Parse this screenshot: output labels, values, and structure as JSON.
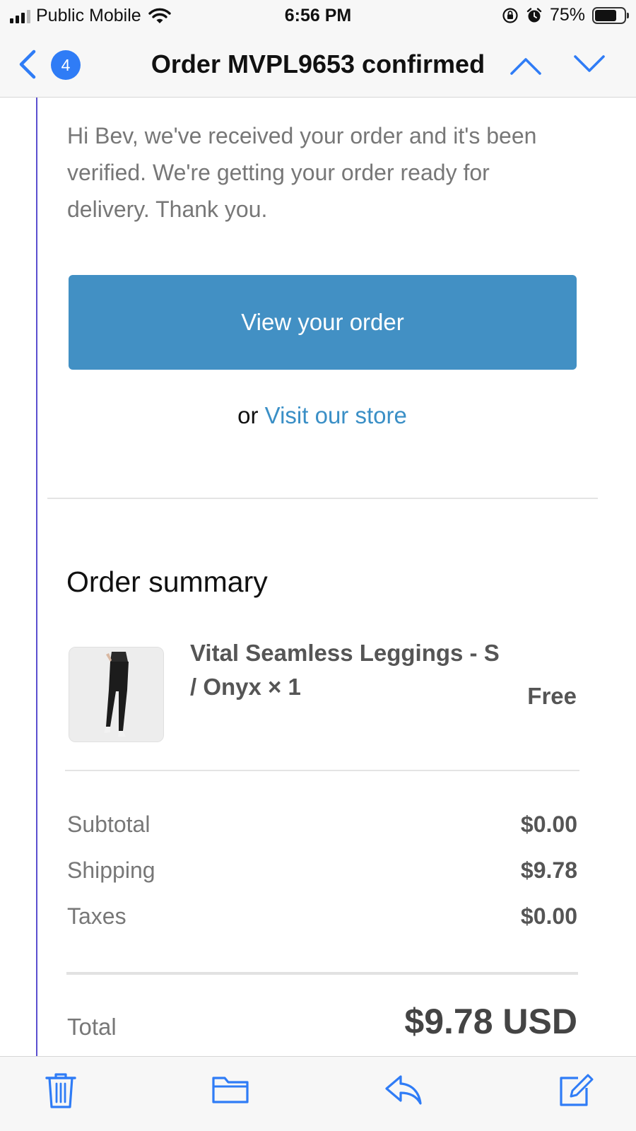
{
  "status_bar": {
    "carrier": "Public Mobile",
    "time": "6:56 PM",
    "battery_percent": "75%",
    "battery_level": 0.75,
    "icons": [
      "signal-icon",
      "wifi-icon",
      "orientation-lock-icon",
      "alarm-icon",
      "battery-icon"
    ]
  },
  "nav": {
    "back_icon": "chevron-left-icon",
    "unread_count": "4",
    "title": "Order MVPL9653 confirmed",
    "prev_icon": "chevron-up-icon",
    "next_icon": "chevron-down-icon"
  },
  "email": {
    "intro": "Hi Bev, we've received your order and it's been verified. We're getting your order ready for delivery. Thank you.",
    "cta_label": "View your order",
    "or_text": "or",
    "store_link": "Visit our store",
    "summary_title": "Order summary",
    "item": {
      "name": "Vital Seamless Leggings - S / Onyx × 1",
      "price": "Free"
    },
    "subtotal": {
      "label": "Subtotal",
      "value": "$0.00"
    },
    "shipping": {
      "label": "Shipping",
      "value": "$9.78"
    },
    "taxes": {
      "label": "Taxes",
      "value": "$0.00"
    },
    "total": {
      "label": "Total",
      "value": "$9.78 USD"
    }
  },
  "toolbar": {
    "icons": [
      "trash-icon",
      "folder-icon",
      "reply-icon",
      "compose-icon"
    ]
  },
  "colors": {
    "accent": "#2f7cf6",
    "button": "#4290c4",
    "link": "#3a8fc6",
    "quote_line": "#5b4fcf"
  }
}
